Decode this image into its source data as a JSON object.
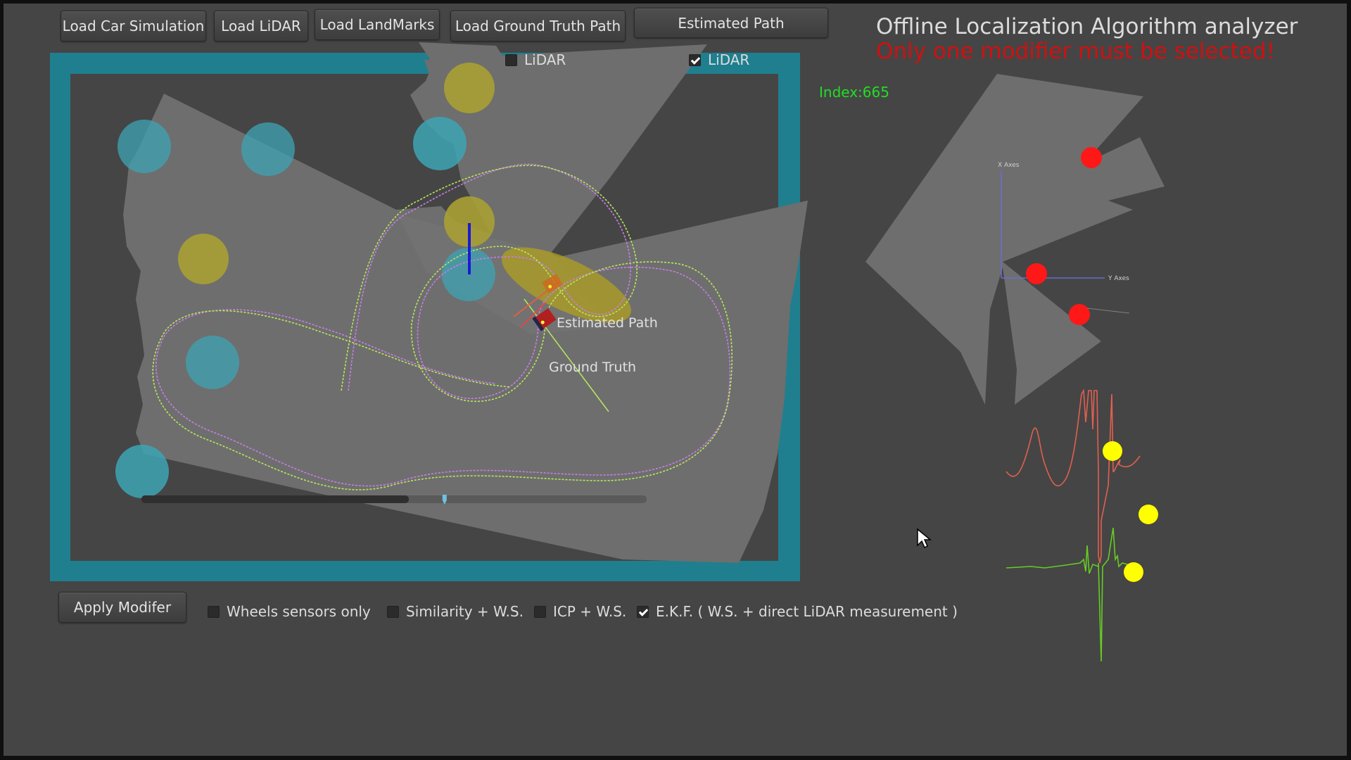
{
  "toolbar": {
    "load_car": "Load Car Simulation",
    "load_lidar": "Load LiDAR",
    "load_landmarks": "Load LandMarks",
    "load_ground_truth": "Load Ground Truth Path",
    "estimated_path": "Estimated Path"
  },
  "header": {
    "title": "Offline Localization Algorithm analyzer",
    "warning": "Only one modifier must be selected!",
    "index": "Index:665"
  },
  "scene": {
    "lidar_toggle_left": {
      "label": "LiDAR",
      "checked": false
    },
    "lidar_toggle_right": {
      "label": "LiDAR",
      "checked": true
    },
    "estimated_path_label": "Estimated Path",
    "ground_truth_label": "Ground Truth",
    "slider_value": 0.6
  },
  "lidar_view": {
    "x_axis_label": "X Axes",
    "y_axis_label": "Y Axes"
  },
  "modifiers": {
    "apply_button": "Apply Modifer",
    "options": [
      {
        "label": "Wheels sensors only",
        "checked": false
      },
      {
        "label": "Similarity + W.S.",
        "checked": false
      },
      {
        "label": "ICP + W.S.",
        "checked": false
      },
      {
        "label": "E.K.F. ( W.S. + direct LiDAR measurement )",
        "checked": true
      }
    ]
  },
  "colors": {
    "background": "#454545",
    "arena_border": "#1f7f8f",
    "landmark_cyan": "#3da4b4",
    "landmark_yellow": "#a9a033",
    "estimated_path": "#c87ee8",
    "ground_truth_path": "#b8e85a",
    "warning": "#d01010",
    "index": "#22dd22",
    "lidar_hits": "#ff1818",
    "signal_red": "#e06050",
    "signal_green": "#66cc22",
    "peak_markers": "#ffff00"
  },
  "icons": [
    "cursor-arrow-icon",
    "checkmark-icon",
    "car-icon"
  ]
}
